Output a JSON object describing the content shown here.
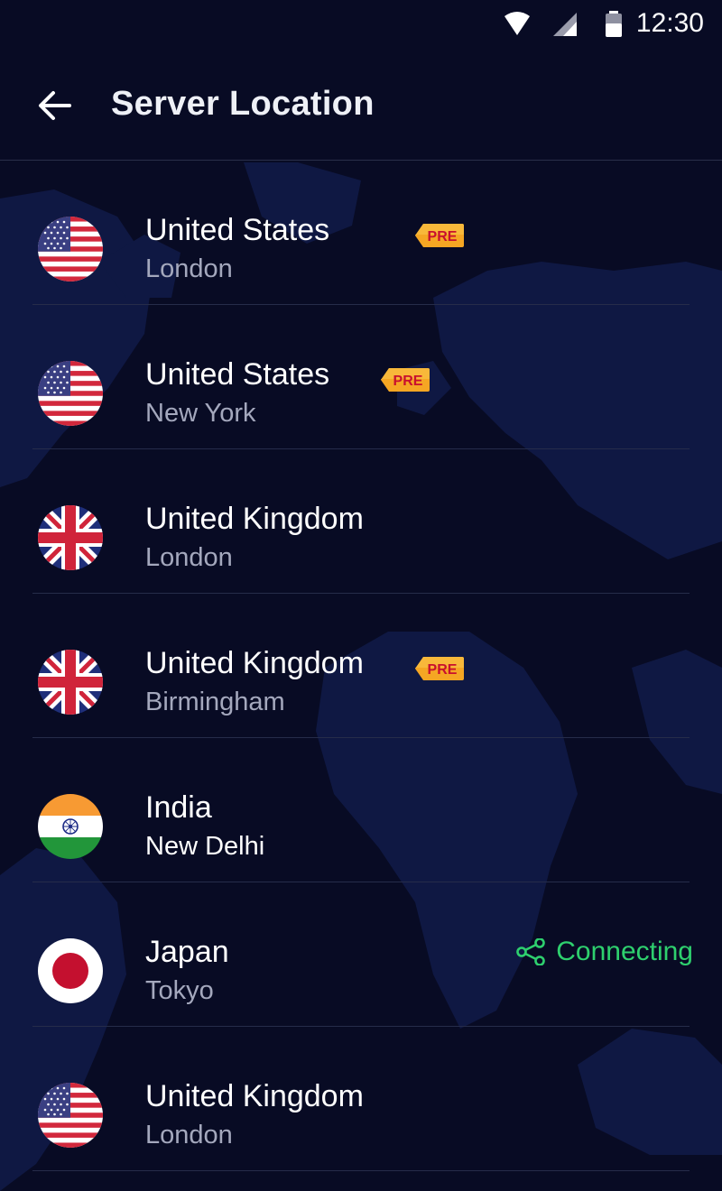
{
  "status_bar": {
    "time": "12:30",
    "icons": [
      "wifi-icon",
      "cellular-signal-icon",
      "battery-icon"
    ]
  },
  "header": {
    "back_icon": "arrow-left-icon",
    "title": "Server Location"
  },
  "badge_label": "PRE",
  "servers": [
    {
      "country": "United States",
      "city": "London",
      "flag": "us-flag-icon",
      "premium": true,
      "status": ""
    },
    {
      "country": "United States",
      "city": "New York",
      "flag": "us-flag-icon",
      "premium": true,
      "status": ""
    },
    {
      "country": "United Kingdom",
      "city": "London",
      "flag": "uk-flag-icon",
      "premium": false,
      "status": ""
    },
    {
      "country": "United Kingdom",
      "city": "Birmingham",
      "flag": "uk-flag-icon",
      "premium": true,
      "status": ""
    },
    {
      "country": "India",
      "city": "New Delhi",
      "flag": "india-flag-icon",
      "premium": false,
      "status": ""
    },
    {
      "country": "Japan",
      "city": "Tokyo",
      "flag": "japan-flag-icon",
      "premium": false,
      "status": "Connecting",
      "status_icon": "share-nodes-icon"
    },
    {
      "country": "United Kingdom",
      "city": "London",
      "flag": "us-flag-icon",
      "premium": false,
      "status": ""
    }
  ],
  "colors": {
    "background": "#080b24",
    "map": "#101a45",
    "badge": "#f5a623",
    "badge_text": "#c8102e",
    "connecting": "#2ed06e",
    "secondary_text": "#a4a8bd"
  }
}
